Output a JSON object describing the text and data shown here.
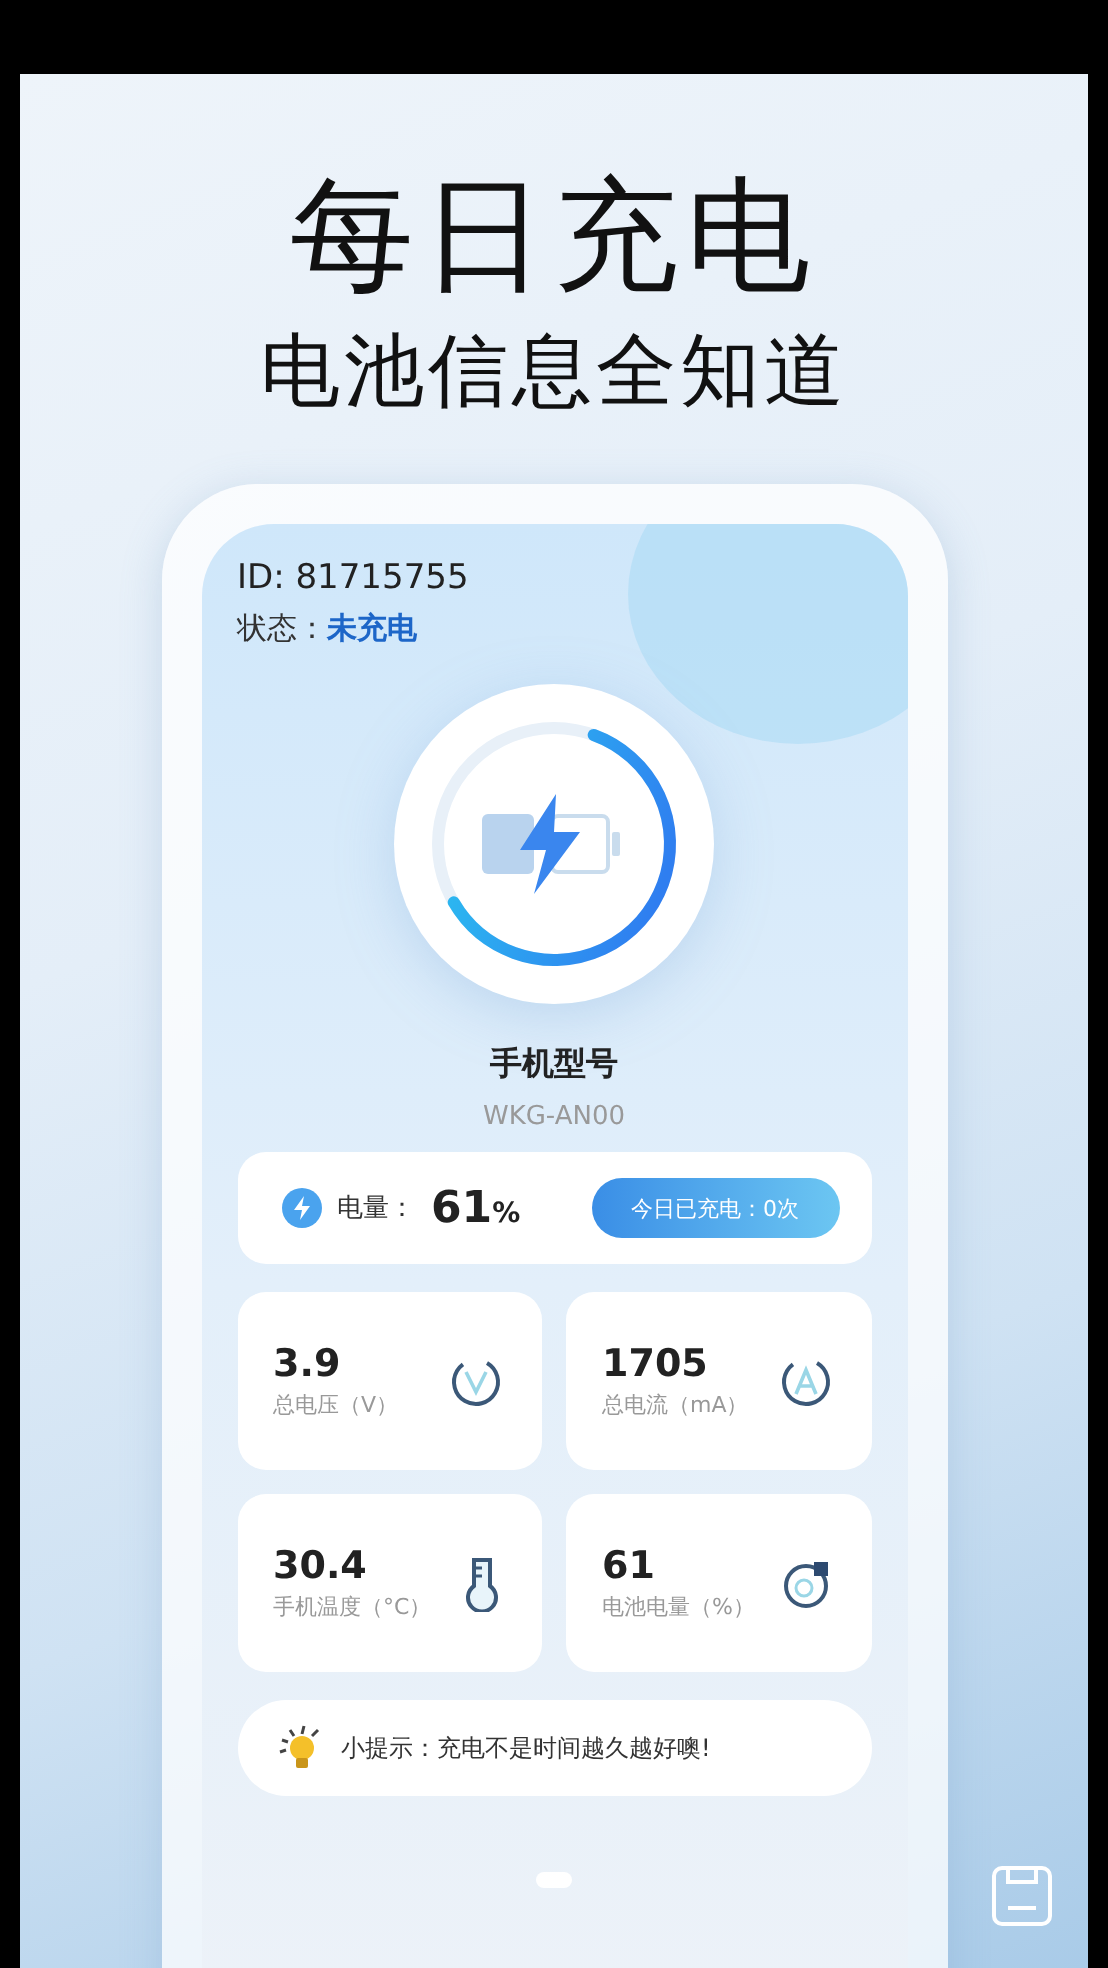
{
  "headline": "每日充电",
  "subheadline": "电池信息全知道",
  "device": {
    "id": "ID: 81715755",
    "status_label": "状态：",
    "status_value": "未充电",
    "charge_ring": {
      "level": 0.61
    },
    "model_label": "手机型号",
    "model_value": "WKG-AN00"
  },
  "battery": {
    "label": "电量：",
    "value": "61",
    "unit": "%",
    "today_button": "今日已充电：0次"
  },
  "stats": [
    {
      "kind": "voltage",
      "value": "3.9",
      "label": "总电压（V）"
    },
    {
      "kind": "current",
      "value": "1705",
      "label": "总电流（mA）"
    },
    {
      "kind": "temperature",
      "value": "30.4",
      "label": "手机温度（°C）"
    },
    {
      "kind": "capacity",
      "value": "61",
      "label": "电池电量（%）"
    }
  ],
  "tip": "小提示：充电不是时间越久越好噢!"
}
